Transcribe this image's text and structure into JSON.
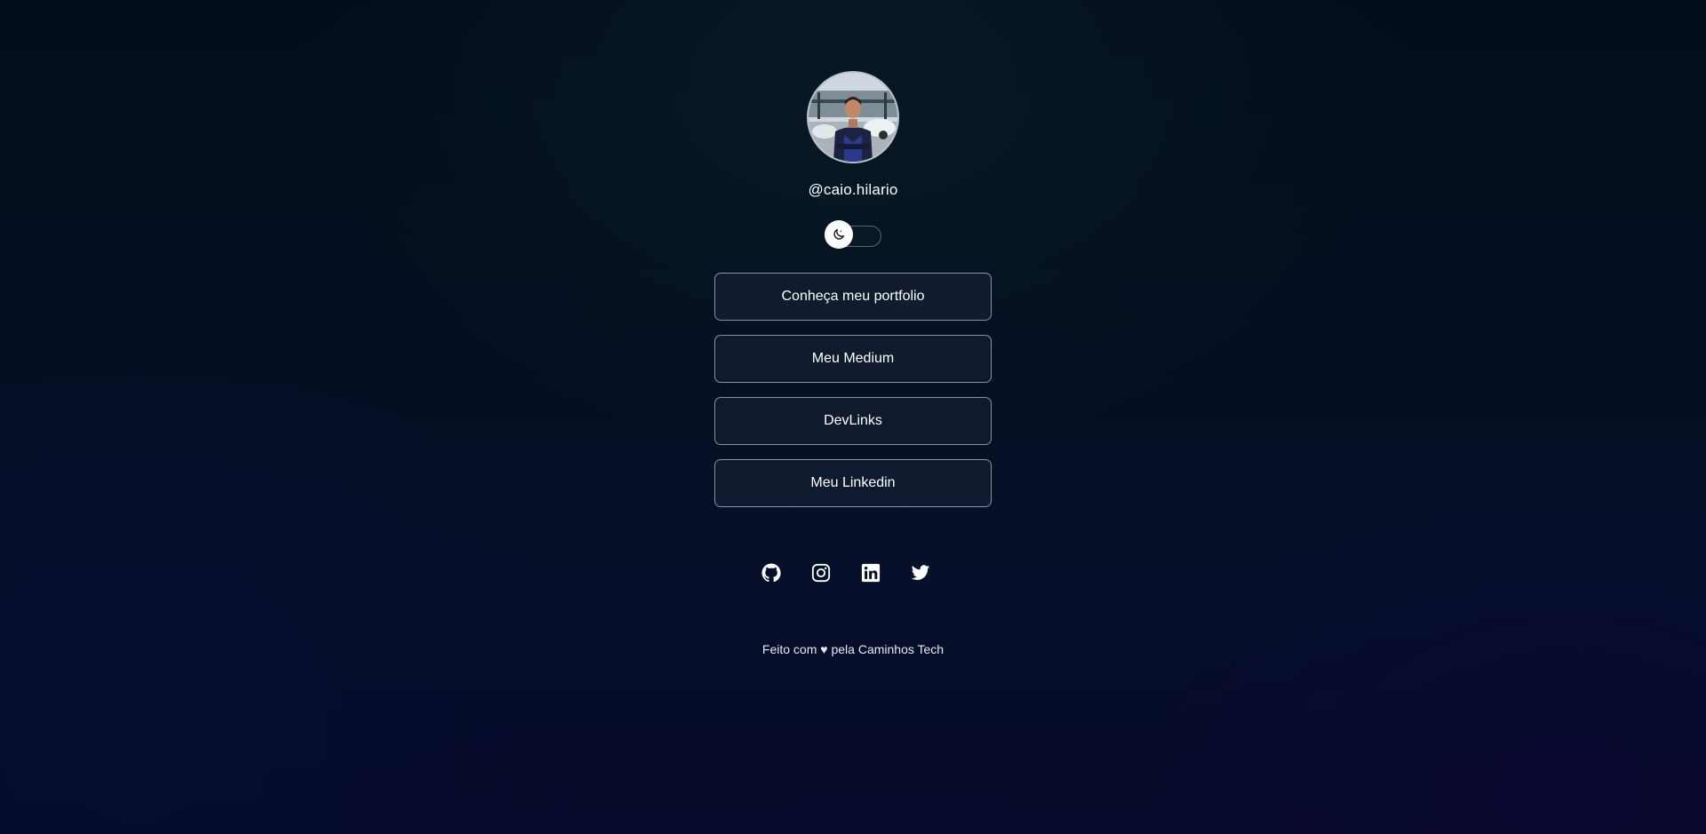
{
  "profile": {
    "username": "@caio.hilario"
  },
  "theme_toggle": {
    "icon": "moon-icon"
  },
  "links": [
    {
      "label": "Conheça meu portfolio"
    },
    {
      "label": "Meu Medium"
    },
    {
      "label": "DevLinks"
    },
    {
      "label": "Meu Linkedin"
    }
  ],
  "socials": [
    {
      "icon": "github-icon"
    },
    {
      "icon": "instagram-icon"
    },
    {
      "icon": "linkedin-icon"
    },
    {
      "icon": "twitter-icon"
    }
  ],
  "footer": {
    "text": "Feito com ♥ pela Caminhos Tech"
  },
  "colors": {
    "background": "#050f22",
    "button_border": "#8b93a1",
    "text": "#ffffff"
  }
}
